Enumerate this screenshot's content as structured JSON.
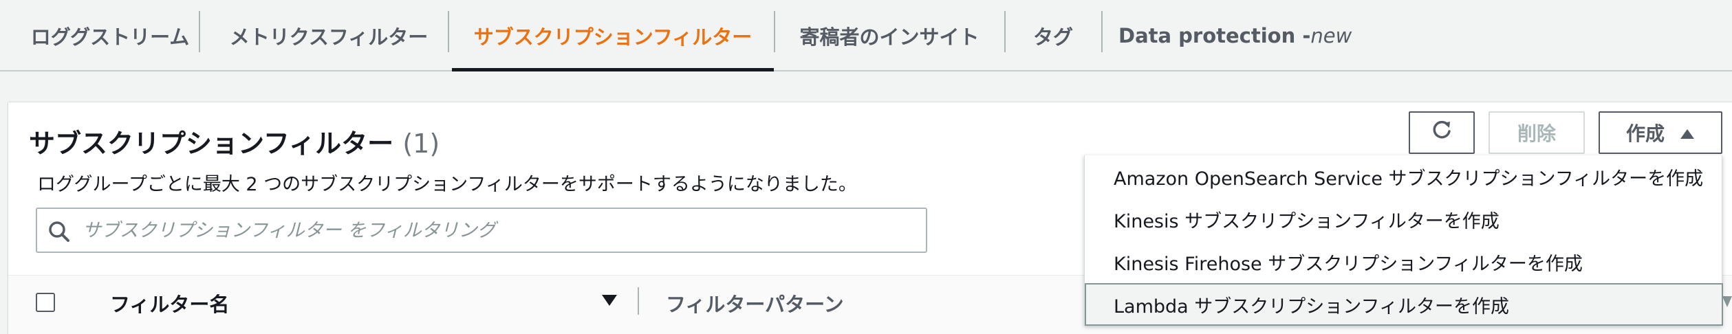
{
  "tabs": [
    {
      "label": "ロググストリーム"
    },
    {
      "label": "メトリクスフィルター"
    },
    {
      "label": "サブスクリプションフィルター"
    },
    {
      "label": "寄稿者のインサイト"
    },
    {
      "label": "タグ"
    },
    {
      "label": "Data protection - ",
      "suffix": "new"
    }
  ],
  "active_tab_index": 2,
  "panel": {
    "title": "サブスクリプションフィルター",
    "count": "(1)",
    "description": "ロググループごとに最大 2 つのサブスクリプションフィルターをサポートするようになりました。"
  },
  "search": {
    "placeholder": "サブスクリプションフィルター をフィルタリング",
    "value": ""
  },
  "actions": {
    "refresh_icon": "refresh-icon",
    "delete_label": "削除",
    "create_label": "作成",
    "create_icon": "caret-up-icon"
  },
  "table": {
    "columns": [
      "フィルター名",
      "フィルターパターン"
    ]
  },
  "create_menu": {
    "items": [
      "Amazon OpenSearch Service サブスクリプションフィルターを作成",
      "Kinesis サブスクリプションフィルターを作成",
      "Kinesis Firehose サブスクリプションフィルターを作成",
      "Lambda サブスクリプションフィルターを作成"
    ],
    "highlighted_index": 3
  },
  "colors": {
    "active_tab": "#ec7211",
    "text": "#16191f",
    "muted": "#545b64",
    "disabled": "#aab7b8",
    "page_bg": "#f2f3f3"
  }
}
